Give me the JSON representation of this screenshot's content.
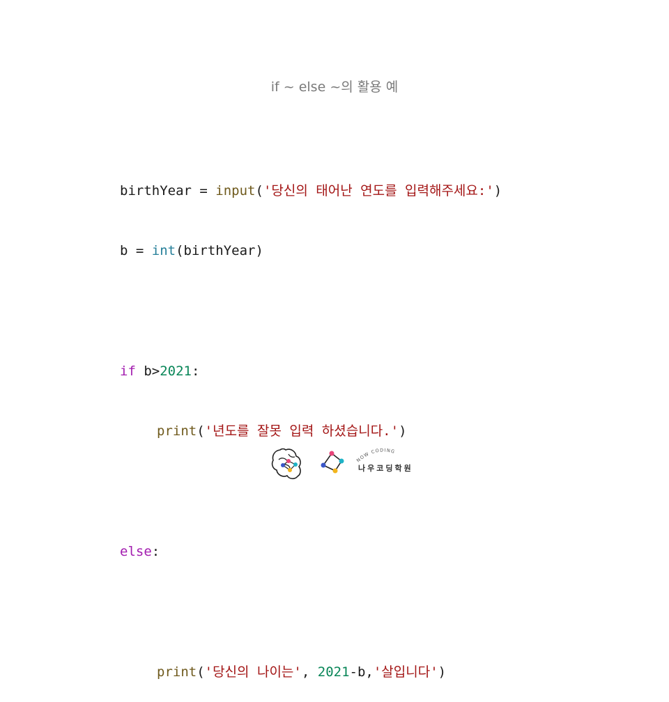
{
  "slide": {
    "title": "if ~ else ~의 활용 예"
  },
  "code": {
    "line1": {
      "var": "birthYear",
      "op": " = ",
      "fn": "input",
      "open": "(",
      "str": "'당신의 태어난 연도를 입력해주세요:'",
      "close": ")"
    },
    "line2": {
      "var": "b",
      "op": " = ",
      "fn": "int",
      "rest": "(birthYear)"
    },
    "line4": {
      "kw": "if",
      "cond": " b>",
      "num": "2021",
      "colon": ":"
    },
    "line5": {
      "fn": "print",
      "open": "(",
      "str": "'년도를 잘못 입력 하셨습니다.'",
      "close": ")"
    },
    "line7": {
      "kw": "else",
      "colon": ":"
    },
    "line9": {
      "fn": "print",
      "open": "(",
      "str1": "'당신의 나이는'",
      "sep": ", ",
      "num": "2021",
      "minus": "-b,",
      "str2": "'살입니다'",
      "close": ")"
    }
  },
  "footer": {
    "brand_arc": "NOW CODING",
    "brand_name": "나우코딩학원"
  }
}
